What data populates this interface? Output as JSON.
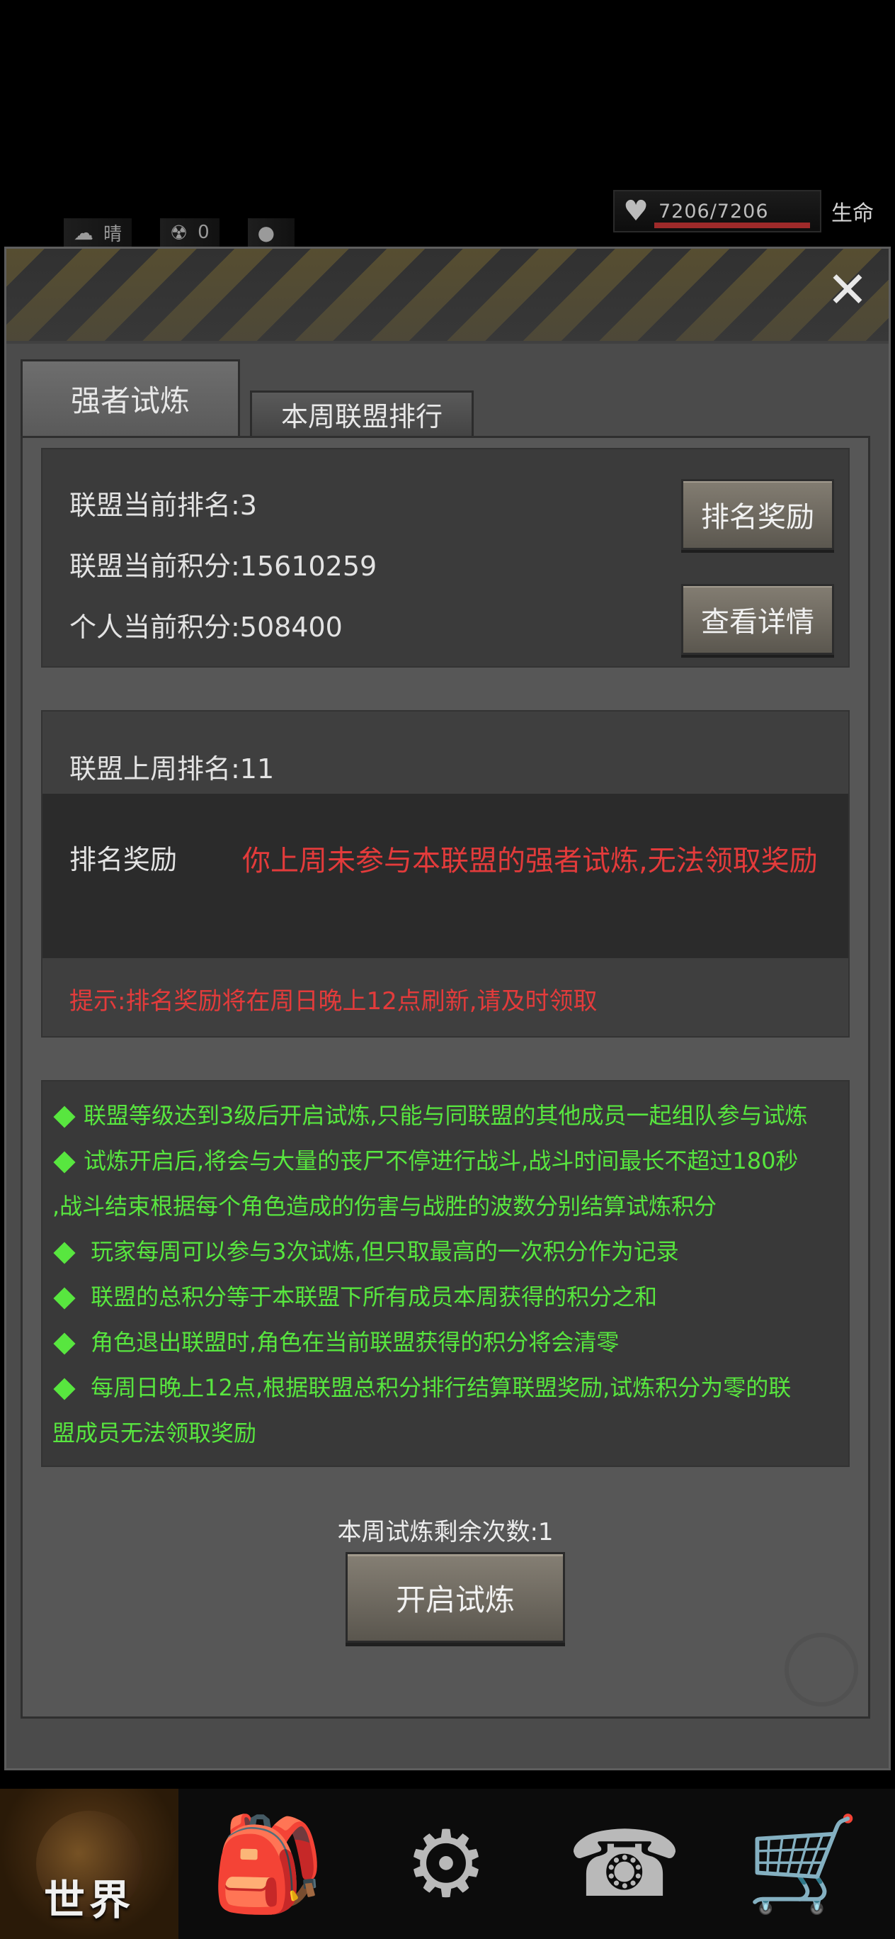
{
  "status": {
    "hp_text": "7206/7206",
    "hp_label": "生命",
    "hp_fraction": 1.0,
    "weather": "晴",
    "radiation": "0"
  },
  "tabs": [
    {
      "label": "强者试炼",
      "active": true
    },
    {
      "label": "本周联盟排行",
      "active": false
    }
  ],
  "summary": {
    "rank": "联盟当前排名:3",
    "alliance_score": "联盟当前积分:15610259",
    "personal_score": "个人当前积分:508400",
    "rank_reward_button": "排名奖励",
    "details_button": "查看详情"
  },
  "last_week": {
    "rank": "联盟上周排名:11",
    "reward_label": "排名奖励",
    "reward_message": "你上周未参与本联盟的强者试炼,无法领取奖励",
    "tip": "提示:排名奖励将在周日晚上12点刷新,请及时领取"
  },
  "rules": [
    "联盟等级达到3级后开启试炼,只能与同联盟的其他成员一起组队参与试炼",
    "试炼开启后,将会与大量的丧尸不停进行战斗,战斗时间最长不超过180秒",
    ",战斗结束根据每个角色造成的伤害与战胜的波数分别结算试炼积分",
    " 玩家每周可以参与3次试炼,但只取最高的一次积分作为记录",
    " 联盟的总积分等于本联盟下所有成员本周获得的积分之和",
    " 角色退出联盟时,角色在当前联盟获得的积分将会清零",
    " 每周日晚上12点,根据联盟总积分排行结算联盟奖励,试炼积分为零的联",
    "盟成员无法领取奖励"
  ],
  "remaining": "本周试炼剩余次数:1",
  "start_button": "开启试炼",
  "nav": {
    "world_label": "世界"
  },
  "colors": {
    "rule_green": "#58e63f",
    "warning_red": "#e33b3b"
  }
}
